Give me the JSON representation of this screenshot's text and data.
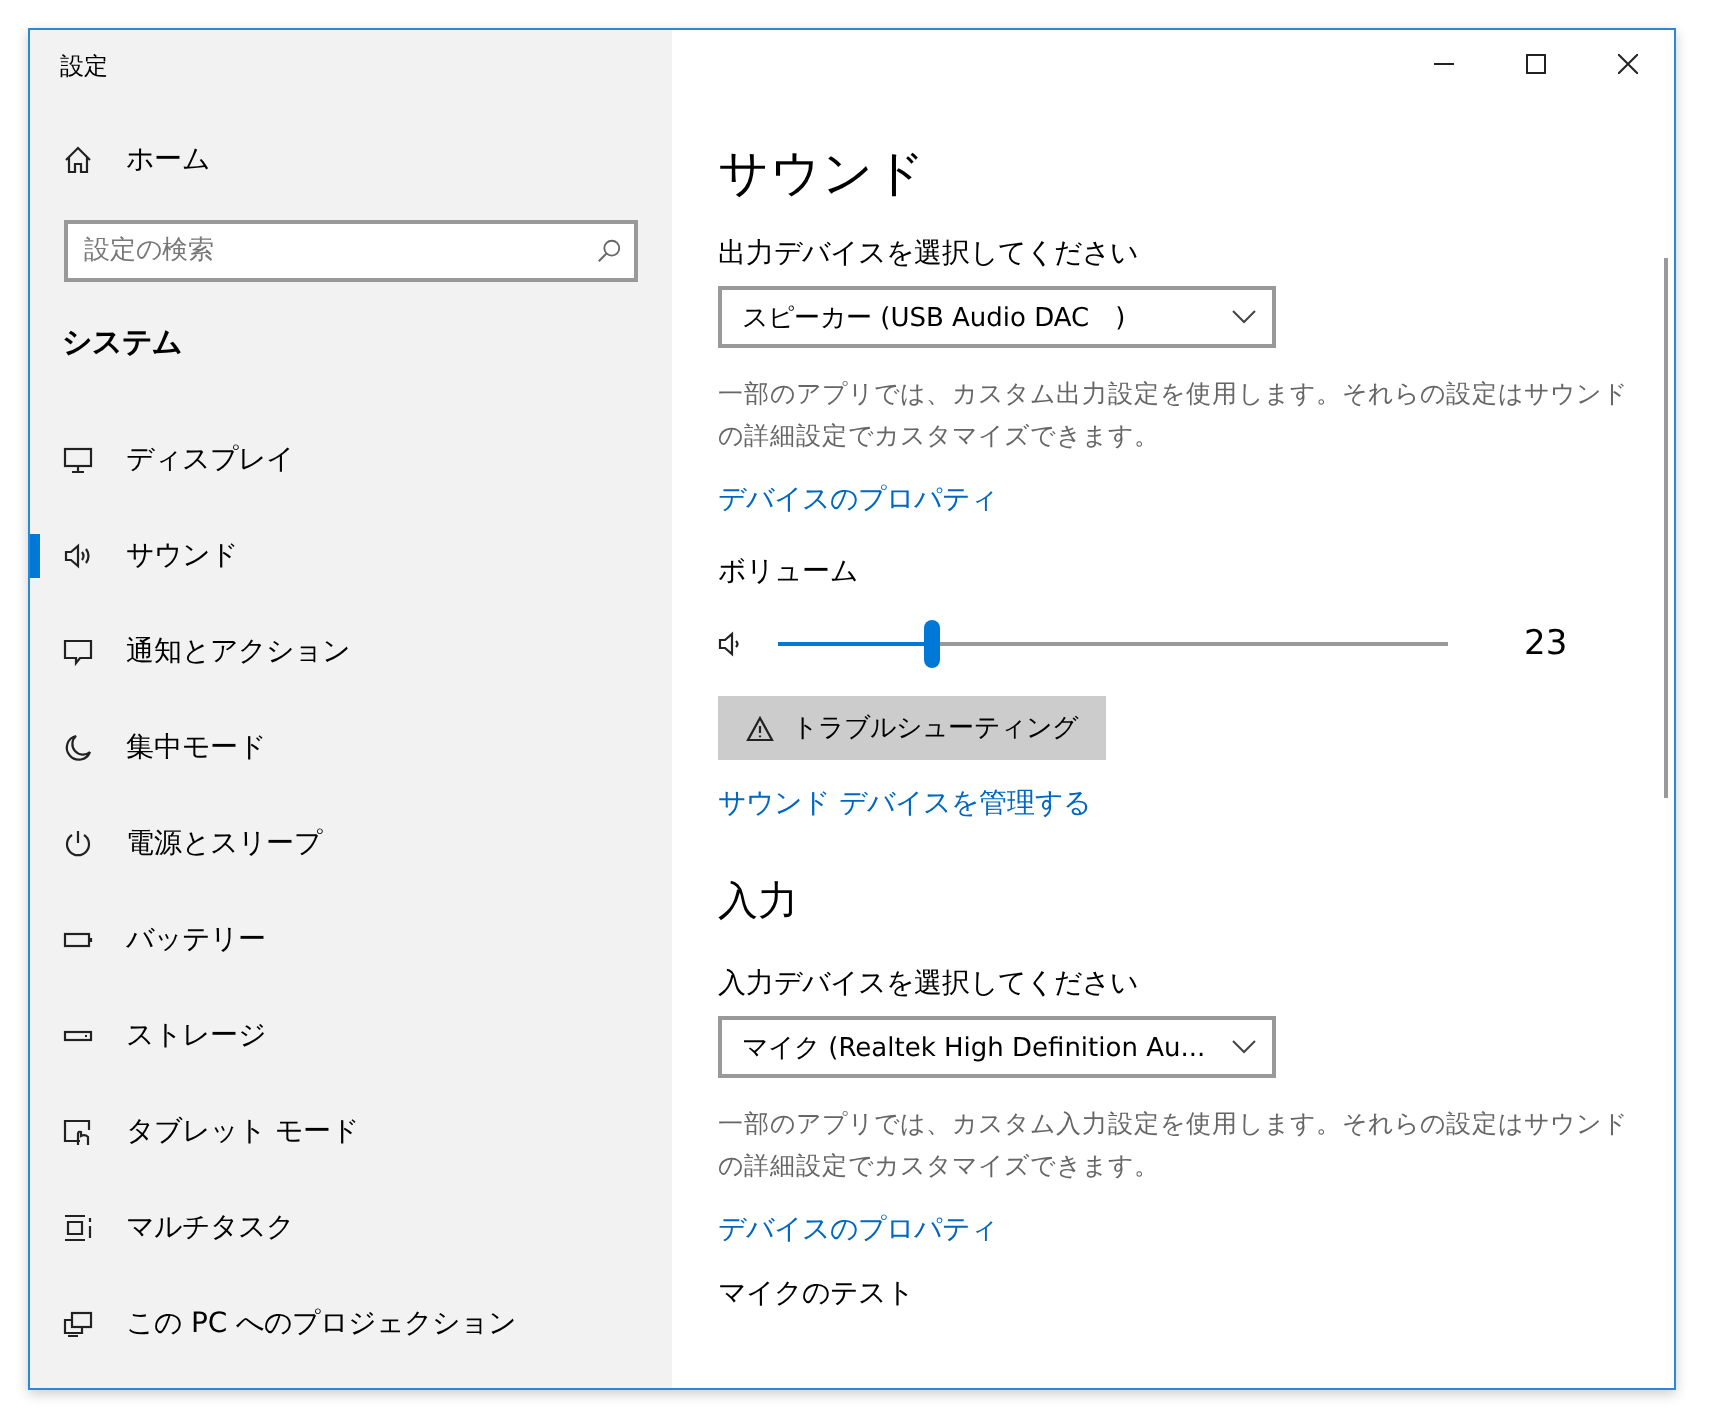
{
  "window": {
    "title": "設定"
  },
  "sidebar": {
    "home": "ホーム",
    "search": {
      "placeholder": "設定の検索"
    },
    "section": "システム",
    "items": [
      {
        "label": "ディスプレイ",
        "selected": false
      },
      {
        "label": "サウンド",
        "selected": true
      },
      {
        "label": "通知とアクション",
        "selected": false
      },
      {
        "label": "集中モード",
        "selected": false
      },
      {
        "label": "電源とスリープ",
        "selected": false
      },
      {
        "label": "バッテリー",
        "selected": false
      },
      {
        "label": "ストレージ",
        "selected": false
      },
      {
        "label": "タブレット モード",
        "selected": false
      },
      {
        "label": "マルチタスク",
        "selected": false
      },
      {
        "label": "この PC へのプロジェクション",
        "selected": false
      }
    ]
  },
  "page": {
    "title": "サウンド",
    "output": {
      "label": "出力デバイスを選択してください",
      "device": "スピーカー (USB Audio DAC　)",
      "description": "一部のアプリでは、カスタム出力設定を使用します。それらの設定はサウンドの詳細設定でカスタマイズできます。",
      "link": "デバイスのプロパティ",
      "volume_label": "ボリューム",
      "volume": {
        "level": 0.23,
        "reading": "23"
      },
      "troubleshoot": "トラブルシューティング",
      "manage_link": "サウンド デバイスを管理する"
    },
    "input_heading": "入力",
    "input": {
      "label": "入力デバイスを選択してください",
      "device": "マイク (Realtek High Definition Au...",
      "description": "一部のアプリでは、カスタム入力設定を使用します。それらの設定はサウンドの詳細設定でカスタマイズできます。",
      "link": "デバイスのプロパティ",
      "test_label": "マイクのテスト"
    }
  }
}
